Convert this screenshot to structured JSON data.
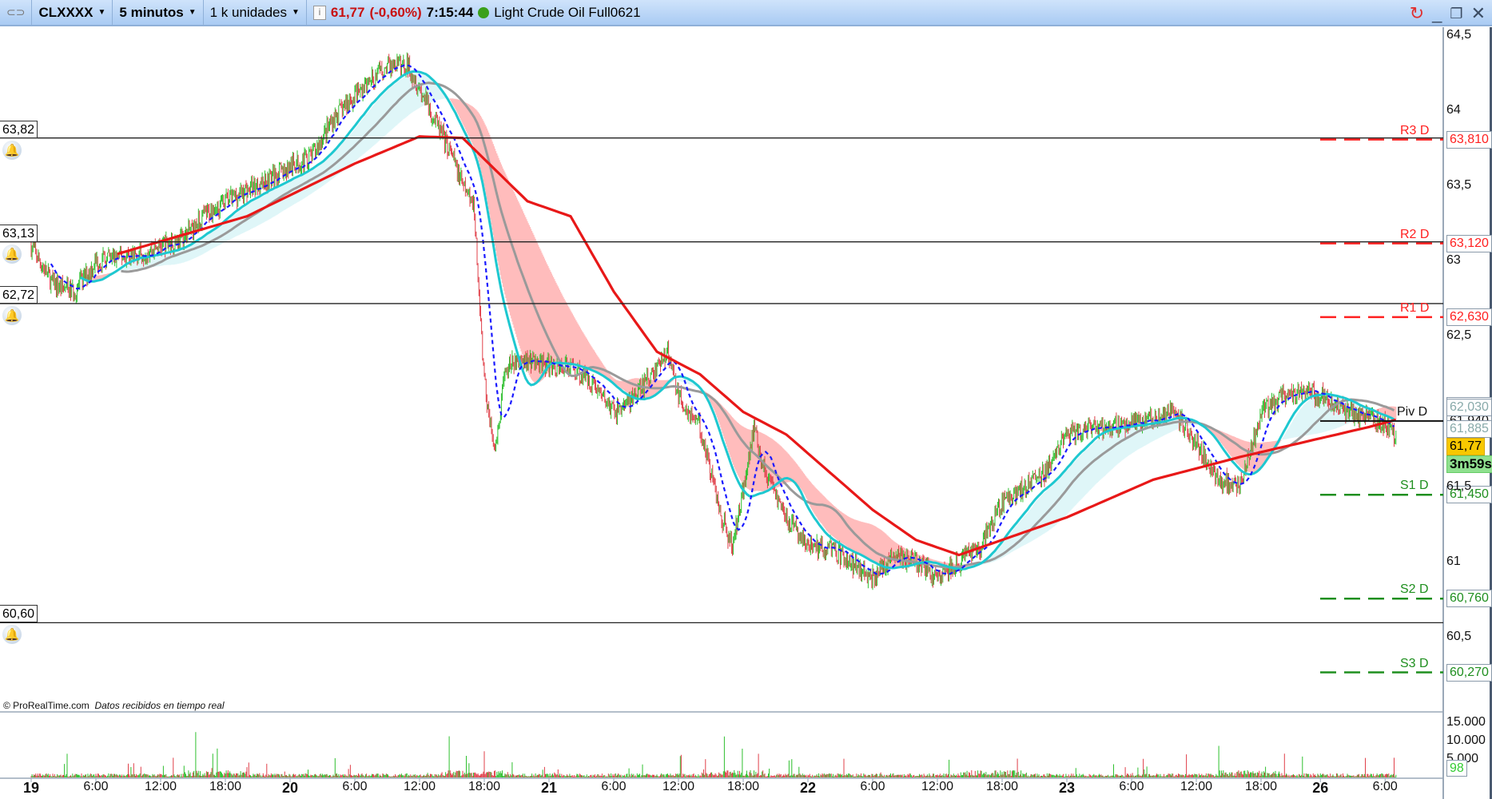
{
  "header": {
    "symbol": "CLXXXX",
    "timeframe": "5 minutos",
    "units": "1 k unidades",
    "price": "61,77",
    "change": "(-0,60%)",
    "time": "7:15:44",
    "instrument": "Light Crude Oil Full0621"
  },
  "colors": {
    "up": "#2fc02f",
    "down": "#e0404a",
    "ma_slow": "#e81818",
    "ma_mid": "#9a9a9a",
    "ma_fast": "#1ec8d0",
    "kijun": "#1a1aff",
    "pivot_r": "#ff2020",
    "pivot_s": "#1f8f1f"
  },
  "alerts": [
    {
      "label": "63,82",
      "value": 63.82
    },
    {
      "label": "63,13",
      "value": 63.13
    },
    {
      "label": "62,72",
      "value": 62.72
    },
    {
      "label": "60,60",
      "value": 60.6
    }
  ],
  "pivots": [
    {
      "name": "R3 D",
      "label": "63,810",
      "value": 63.81,
      "kind": "r"
    },
    {
      "name": "R2 D",
      "label": "63,120",
      "value": 63.12,
      "kind": "r"
    },
    {
      "name": "R1 D",
      "label": "62,630",
      "value": 62.63,
      "kind": "r"
    },
    {
      "name": "Piv D",
      "label": "61,940",
      "value": 61.94,
      "kind": "p"
    },
    {
      "name": "S1 D",
      "label": "61,450",
      "value": 61.45,
      "kind": "s"
    },
    {
      "name": "S2 D",
      "label": "60,760",
      "value": 60.76,
      "kind": "s"
    },
    {
      "name": "S3 D",
      "label": "60,270",
      "value": 60.27,
      "kind": "s"
    }
  ],
  "price_axis": {
    "ticks": [
      "64,5",
      "64",
      "63,5",
      "63",
      "62,5",
      "61,5",
      "61",
      "60,5"
    ],
    "tick_values": [
      64.5,
      64,
      63.5,
      63,
      62.5,
      61.5,
      61,
      60.5
    ],
    "indicator_labels": [
      {
        "label": "62,041",
        "value": 62.041
      },
      {
        "label": "62,030",
        "value": 62.03
      },
      {
        "label": "61,885",
        "value": 61.885
      }
    ],
    "last_price": "61,77",
    "last_value": 61.77,
    "countdown": "3m59s"
  },
  "volume_axis": {
    "ticks": [
      "15.000",
      "10.000",
      "5.000"
    ],
    "tick_values": [
      15000,
      10000,
      5000
    ],
    "current": "98"
  },
  "time_axis": [
    {
      "label": "19",
      "h": 0,
      "day": true
    },
    {
      "label": "6:00",
      "h": 6
    },
    {
      "label": "12:00",
      "h": 12
    },
    {
      "label": "18:00",
      "h": 18
    },
    {
      "label": "20",
      "h": 24,
      "day": true
    },
    {
      "label": "6:00",
      "h": 30
    },
    {
      "label": "12:00",
      "h": 36
    },
    {
      "label": "18:00",
      "h": 42
    },
    {
      "label": "21",
      "h": 48,
      "day": true
    },
    {
      "label": "6:00",
      "h": 54
    },
    {
      "label": "12:00",
      "h": 60
    },
    {
      "label": "18:00",
      "h": 66
    },
    {
      "label": "22",
      "h": 72,
      "day": true
    },
    {
      "label": "6:00",
      "h": 78
    },
    {
      "label": "12:00",
      "h": 84
    },
    {
      "label": "18:00",
      "h": 90
    },
    {
      "label": "23",
      "h": 96,
      "day": true
    },
    {
      "label": "6:00",
      "h": 102
    },
    {
      "label": "12:00",
      "h": 108
    },
    {
      "label": "18:00",
      "h": 114
    },
    {
      "label": "26",
      "h": 119.5,
      "day": true
    },
    {
      "label": "6:00",
      "h": 125.5
    }
  ],
  "footer": {
    "copyright": "© ProRealTime.com",
    "realtime": "Datos recibidos en tiempo real"
  },
  "chart_data": {
    "type": "candlestick",
    "title": "CLXXXX 5 minutos",
    "price_path_hours": [
      0,
      2,
      4,
      6,
      10,
      14,
      16,
      18,
      22,
      26,
      28,
      30,
      33,
      35,
      37,
      39,
      40,
      41,
      42,
      43,
      44,
      46,
      48,
      50,
      52,
      54,
      56,
      58,
      59,
      60,
      62,
      63,
      64,
      65,
      66,
      67,
      68,
      70,
      72,
      74,
      76,
      78,
      80,
      82,
      84,
      86,
      88,
      90,
      92,
      94,
      96,
      100,
      104,
      106,
      108,
      110,
      112,
      114,
      116,
      118,
      120,
      122,
      124,
      126,
      126.6
    ],
    "price_path": [
      63.1,
      62.85,
      62.8,
      63.0,
      63.05,
      63.15,
      63.3,
      63.4,
      63.55,
      63.7,
      63.95,
      64.1,
      64.3,
      64.3,
      64.0,
      63.7,
      63.5,
      63.4,
      62.2,
      61.7,
      62.3,
      62.35,
      62.3,
      62.3,
      62.2,
      62.0,
      62.1,
      62.3,
      62.4,
      62.1,
      61.9,
      61.6,
      61.3,
      61.1,
      61.5,
      61.9,
      61.6,
      61.3,
      61.1,
      61.1,
      61.0,
      60.9,
      61.05,
      61.0,
      60.9,
      61.0,
      61.1,
      61.4,
      61.5,
      61.6,
      61.85,
      61.9,
      61.95,
      62.0,
      61.8,
      61.55,
      61.5,
      62.0,
      62.1,
      62.15,
      62.1,
      62.0,
      61.95,
      61.9,
      61.77
    ],
    "ma_slow_hours": [
      8,
      20,
      30,
      36,
      40,
      46,
      50,
      54,
      58,
      62,
      66,
      70,
      74,
      78,
      82,
      86,
      90,
      96,
      104,
      112,
      118,
      124,
      126.6
    ],
    "ma_slow": [
      63.05,
      63.3,
      63.65,
      63.83,
      63.82,
      63.4,
      63.3,
      62.8,
      62.4,
      62.25,
      62.0,
      61.85,
      61.6,
      61.35,
      61.15,
      61.05,
      61.15,
      61.3,
      61.55,
      61.7,
      61.8,
      61.9,
      61.95
    ],
    "ylim": [
      60.2,
      64.6
    ]
  }
}
